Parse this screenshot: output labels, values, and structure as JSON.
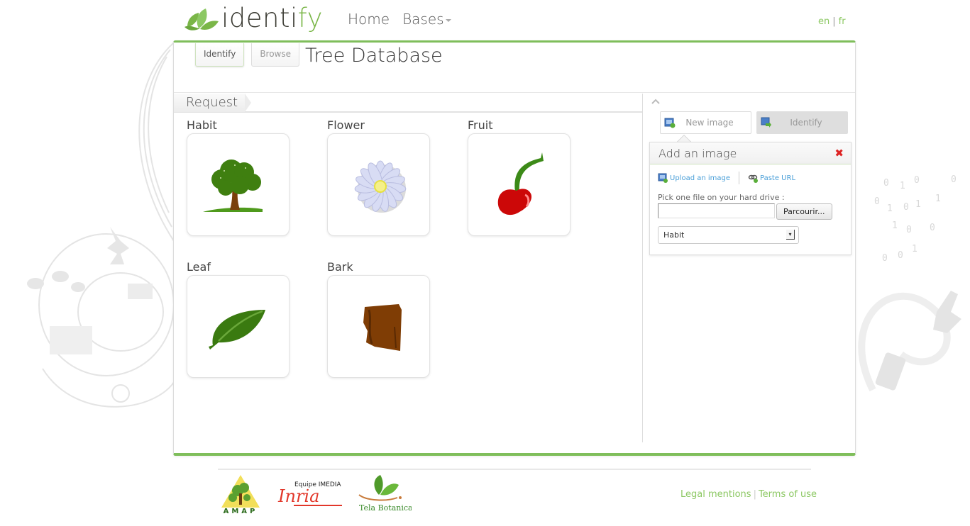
{
  "app": {
    "logo_prefix": "identi",
    "logo_highlight": "fy"
  },
  "nav": {
    "items": [
      {
        "label": "Home"
      },
      {
        "label": "Bases"
      }
    ]
  },
  "lang": {
    "en": "en",
    "separator": "|",
    "fr": "fr"
  },
  "tabs": [
    {
      "label": "Identify",
      "active": true
    },
    {
      "label": "Browse",
      "active": false
    }
  ],
  "page_title": "Tree Database",
  "request": {
    "title": "Request",
    "organs": [
      {
        "label": "Habit",
        "icon": "tree-icon"
      },
      {
        "label": "Flower",
        "icon": "daisy-flower-icon"
      },
      {
        "label": "Fruit",
        "icon": "cherry-icon"
      },
      {
        "label": "Leaf",
        "icon": "leaf-icon"
      },
      {
        "label": "Bark",
        "icon": "bark-icon"
      }
    ]
  },
  "side_panel": {
    "new_image_label": "New image",
    "identify_label": "Identify",
    "add_image": {
      "title": "Add an image",
      "upload_label": "Upload an image",
      "paste_url_label": "Paste URL",
      "pick_label": "Pick one file on your hard drive :",
      "file_value": "",
      "browse_label": "Parcourir...",
      "organ_select_value": "Habit"
    }
  },
  "footer": {
    "partners": [
      {
        "name": "AMAP",
        "text": "AMAP"
      },
      {
        "name": "Inria",
        "text": "Inria",
        "subtitle": "Equipe IMEDIA"
      },
      {
        "name": "Tela Botanica",
        "text": "Tela Botanica"
      }
    ],
    "legal_label": "Legal mentions",
    "separator": "|",
    "terms_label": "Terms of use"
  },
  "colors": {
    "accent_green": "#7fbe5b",
    "link_blue": "#4a9fd8",
    "close_red": "#dd2222"
  }
}
